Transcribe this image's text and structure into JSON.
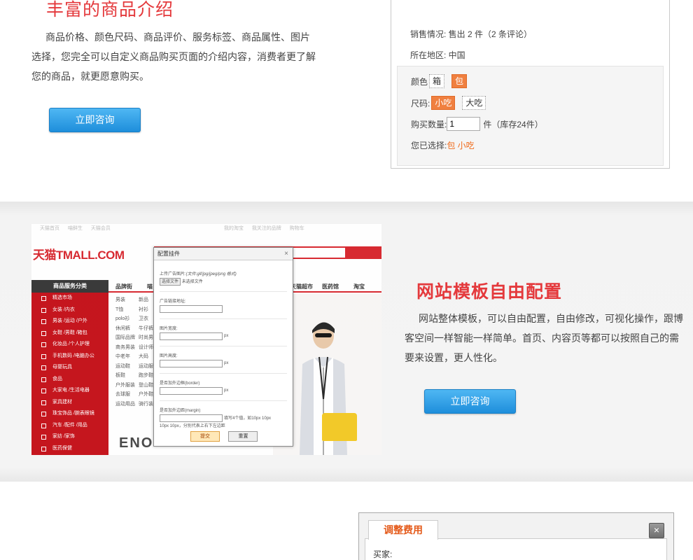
{
  "section1": {
    "title": "丰富的商品介绍",
    "desc": "商品价格、颜色尺码、商品评价、服务标签、商品属性、图片选择，您完全可以自定义商品购买页面的介绍内容，消费者更了解您的商品，就更愿意购买。",
    "button": "立即咨询",
    "product": {
      "sales": "销售情况: 售出 2 件（2 条评论）",
      "region": "所在地区: 中国",
      "color_label": "颜色",
      "color_options": [
        "箱",
        "包"
      ],
      "size_label": "尺码:",
      "size_options": [
        "小吃",
        "大吃"
      ],
      "qty_label": "购买数量:",
      "qty_value": "1",
      "qty_suffix": "件（库存24件）",
      "chosen_label": "您已选择:",
      "chosen_value": "包 小吃"
    }
  },
  "section2": {
    "title": "网站模板自由配置",
    "desc": "网站整体模板，可以自由配置，自由修改，可视化操作，跟博客空间一样智能一样简单。首页、内容页等都可以按照自己的需要来设置，更人性化。",
    "button": "立即咨询",
    "screenshot": {
      "logo": "天猫TMALL.COM",
      "topbar": [
        "天猫首页",
        "喵鲜生",
        "天猫会员",
        "我的淘宝",
        "我关注的品牌",
        "购物车"
      ],
      "nav_head": "商品服务分类",
      "nav_items": [
        "品牌街",
        "喵",
        "天猫超市",
        "医药馆",
        "淘宝"
      ],
      "side_items": [
        "精选市场",
        "女装 /内衣",
        "男装 /运动 /户外",
        "女鞋 /男鞋 /箱包",
        "化妆品 /个人护理",
        "手机数码 /电脑办公",
        "母婴玩具",
        "食品",
        "大家电 /生活电器",
        "家具建材",
        "珠宝饰品 /腕表眼镜",
        "汽车 /配件 /用品",
        "家纺 /家饰",
        "医药保健"
      ],
      "col1": [
        "男装",
        "T恤",
        "polo衫",
        "休闲裤",
        "国际品牌",
        "商务男装",
        "中老年",
        "运动鞋",
        "板鞋",
        "户外服装",
        "去球服",
        "运动用品"
      ],
      "col2": [
        "新品",
        "衬衫",
        "卫衣",
        "牛仔裤",
        "时尚男装",
        "设计师",
        "大码",
        "运动服",
        "跑步鞋",
        "登山鞋",
        "户外鞋",
        "骑行装备"
      ],
      "brand": "ENO",
      "dialog": {
        "title": "配置挂件",
        "close": "×",
        "upload_label": "上传广告图片:",
        "upload_hint": "(文件:gif/jpg/jpeg/png 格式)",
        "choose_file": "选择文件",
        "no_file": "未选择文件",
        "link_label": "广告链接地址:",
        "width_label": "图片宽度:",
        "height_label": "图片高度:",
        "border_label": "是否加外边框(border)",
        "margin_label": "是否加外边距(margin)",
        "margin_hint": "填写4个值，如10px 10px",
        "margin_hint2": "10px 10px，分别代表上右下左边距",
        "unit": "px",
        "submit": "提交",
        "reset": "重置"
      }
    }
  },
  "section3": {
    "tab": "调整费用",
    "close": "×",
    "buyer_label": "买家:"
  },
  "colors": {
    "title_red": "#e4393c",
    "button_blue": "#1e8edb",
    "option_orange": "#f08040"
  }
}
